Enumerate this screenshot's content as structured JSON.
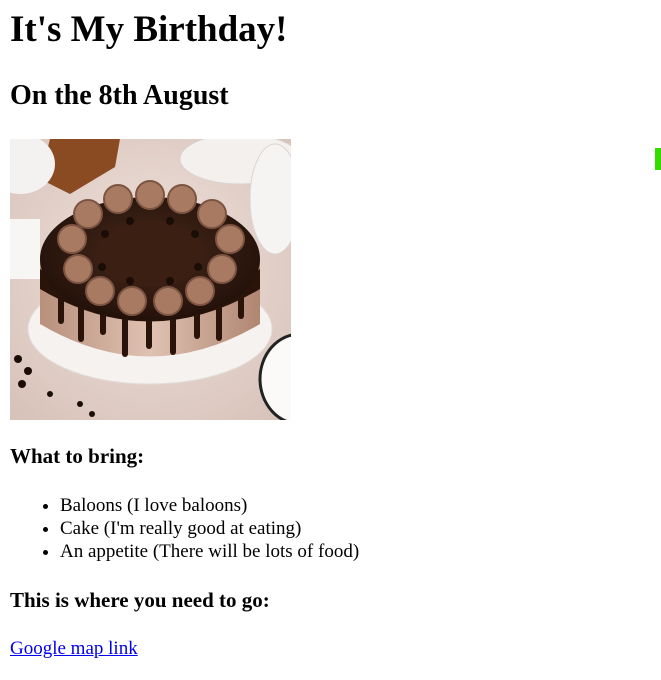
{
  "heading": "It's My Birthday!",
  "subheading": "On the 8th August",
  "image": {
    "alt": "chocolate drip cake"
  },
  "bring": {
    "heading": "What to bring:",
    "items": [
      "Baloons (I love baloons)",
      "Cake (I'm really good at eating)",
      "An appetite (There will be lots of food)"
    ]
  },
  "location": {
    "heading": "This is where you need to go:",
    "link_text": "Google map link"
  },
  "colors": {
    "link": "#0000ee",
    "marker": "#33dd00"
  }
}
